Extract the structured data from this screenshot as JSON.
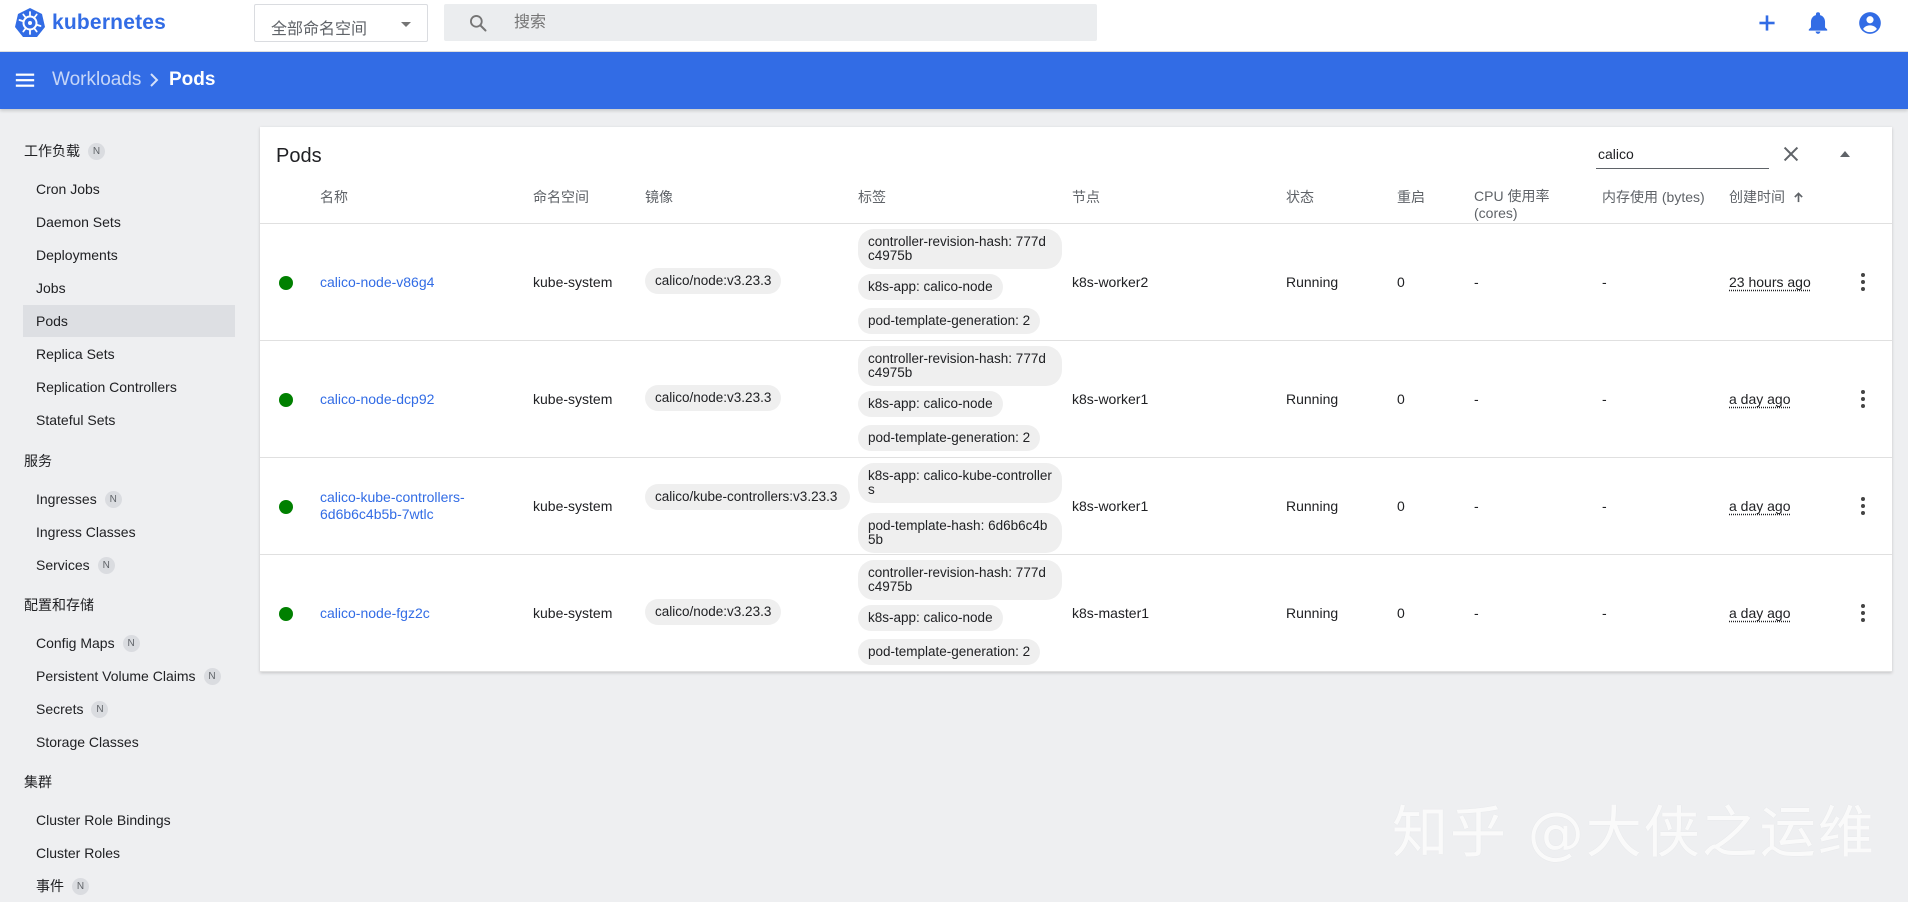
{
  "app": {
    "name": "kubernetes"
  },
  "topbar": {
    "namespace_selected": "全部命名空间",
    "search_placeholder": "搜索"
  },
  "breadcrumb": {
    "parent": "Workloads",
    "current": "Pods"
  },
  "sidebar": {
    "sections": [
      {
        "label": "工作负载",
        "badge": "N"
      },
      {
        "label": "服务"
      },
      {
        "label": "配置和存储"
      },
      {
        "label": "集群"
      }
    ],
    "workloads": [
      {
        "label": "Cron Jobs"
      },
      {
        "label": "Daemon Sets"
      },
      {
        "label": "Deployments"
      },
      {
        "label": "Jobs"
      },
      {
        "label": "Pods"
      },
      {
        "label": "Replica Sets"
      },
      {
        "label": "Replication Controllers"
      },
      {
        "label": "Stateful Sets"
      }
    ],
    "services": [
      {
        "label": "Ingresses",
        "badge": "N"
      },
      {
        "label": "Ingress Classes"
      },
      {
        "label": "Services",
        "badge": "N"
      }
    ],
    "config": [
      {
        "label": "Config Maps",
        "badge": "N"
      },
      {
        "label": "Persistent Volume Claims",
        "badge": "N"
      },
      {
        "label": "Secrets",
        "badge": "N"
      },
      {
        "label": "Storage Classes"
      }
    ],
    "cluster": [
      {
        "label": "Cluster Role Bindings"
      },
      {
        "label": "Cluster Roles"
      },
      {
        "label": "事件",
        "badge": "N"
      }
    ]
  },
  "card": {
    "title": "Pods",
    "filter_value": "calico",
    "columns": {
      "name": "名称",
      "namespace": "命名空间",
      "images": "镜像",
      "labels": "标签",
      "node": "节点",
      "status": "状态",
      "restarts": "重启",
      "cpu": "CPU 使用率 (cores)",
      "memory": "内存使用 (bytes)",
      "created": "创建时间"
    },
    "rows": [
      {
        "name": "calico-node-v86g4",
        "namespace": "kube-system",
        "image": "calico/node:v3.23.3",
        "labels": [
          "controller-revision-hash: 777dc4975b",
          "k8s-app: calico-node",
          "pod-template-generation: 2"
        ],
        "node": "k8s-worker2",
        "status": "Running",
        "restarts": "0",
        "cpu": "-",
        "memory": "-",
        "created": "23 hours ago"
      },
      {
        "name": "calico-node-dcp92",
        "namespace": "kube-system",
        "image": "calico/node:v3.23.3",
        "labels": [
          "controller-revision-hash: 777dc4975b",
          "k8s-app: calico-node",
          "pod-template-generation: 2"
        ],
        "node": "k8s-worker1",
        "status": "Running",
        "restarts": "0",
        "cpu": "-",
        "memory": "-",
        "created": "a day ago"
      },
      {
        "name": "calico-kube-controllers-6d6b6c4b5b-7wtlc",
        "namespace": "kube-system",
        "image": "calico/kube-controllers:v3.23.3",
        "labels": [
          "k8s-app: calico-kube-controllers",
          "pod-template-hash: 6d6b6c4b5b"
        ],
        "node": "k8s-worker1",
        "status": "Running",
        "restarts": "0",
        "cpu": "-",
        "memory": "-",
        "created": "a day ago"
      },
      {
        "name": "calico-node-fgz2c",
        "namespace": "kube-system",
        "image": "calico/node:v3.23.3",
        "labels": [
          "controller-revision-hash: 777dc4975b",
          "k8s-app: calico-node",
          "pod-template-generation: 2"
        ],
        "node": "k8s-master1",
        "status": "Running",
        "restarts": "0",
        "cpu": "-",
        "memory": "-",
        "created": "a day ago"
      }
    ]
  },
  "watermark": "知乎 @大侠之运维",
  "colors": {
    "primary": "#326ce5",
    "running": "#008000"
  }
}
